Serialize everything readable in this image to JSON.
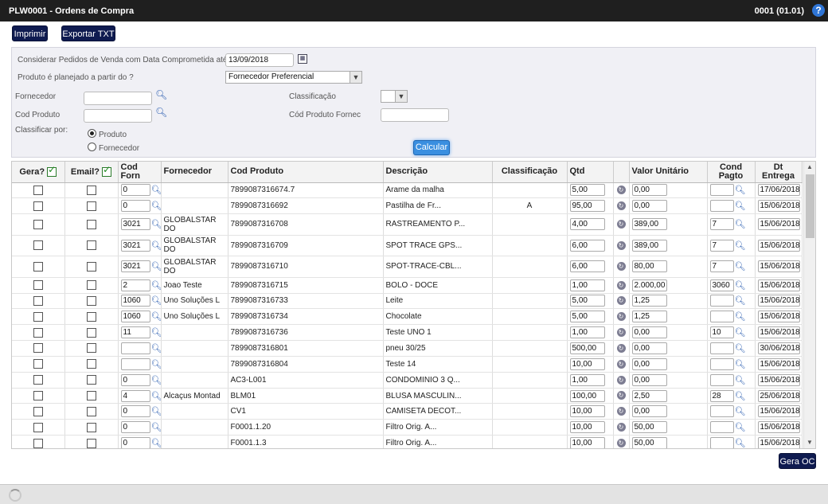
{
  "window": {
    "title": "PLW0001 - Ordens de Compra",
    "code": "0001 (01.01)",
    "help": "?"
  },
  "toolbar": {
    "print_label": "Imprimir",
    "export_label": "Exportar TXT"
  },
  "filters": {
    "data_label": "Considerar Pedidos de Venda com Data Comprometida até",
    "data_value": "13/09/2018",
    "planejado_label": "Produto é planejado a partir do ?",
    "planejado_value": "Fornecedor Preferencial",
    "fornecedor_label": "Fornecedor",
    "fornecedor_value": "",
    "cod_produto_label": "Cod Produto",
    "cod_produto_value": "",
    "classificacao_label": "Classificação",
    "classificacao_value": "",
    "cod_produto_fornec_label": "Cód Produto Fornec",
    "cod_produto_fornec_value": "",
    "classificar_label": "Classificar por:",
    "radio_produto": "Produto",
    "radio_fornecedor": "Fornecedor",
    "radio_selected": "Produto",
    "calcular_label": "Calcular"
  },
  "grid": {
    "headers": {
      "gera": "Gera?",
      "email": "Email?",
      "cod_forn": "Cod Forn",
      "fornecedor": "Fornecedor",
      "cod_produto": "Cod Produto",
      "descricao": "Descrição",
      "classificacao": "Classificação",
      "qtd": "Qtd",
      "valor_unitario": "Valor Unitário",
      "cond_pagto": "Cond Pagto",
      "dt_entrega": "Dt Entrega"
    },
    "header_checks": {
      "gera": true,
      "email": true
    },
    "rows": [
      {
        "cod_forn": "0",
        "fornecedor": "",
        "cod_produto": "7899087316674.7",
        "descricao": "Arame da malha",
        "classificacao": "",
        "qtd": "5,00",
        "valor": "0,00",
        "cond": "",
        "dt": "17/06/2018",
        "tall": false
      },
      {
        "cod_forn": "0",
        "fornecedor": "",
        "cod_produto": "7899087316692",
        "descricao": "Pastilha de Fr...",
        "classificacao": "A",
        "qtd": "95,00",
        "valor": "0,00",
        "cond": "",
        "dt": "15/06/2018",
        "tall": false
      },
      {
        "cod_forn": "3021",
        "fornecedor": "GLOBALSTAR DO",
        "cod_produto": "7899087316708",
        "descricao": "RASTREAMENTO P...",
        "classificacao": "",
        "qtd": "4,00",
        "valor": "389,00",
        "cond": "7",
        "dt": "15/06/2018",
        "tall": true
      },
      {
        "cod_forn": "3021",
        "fornecedor": "GLOBALSTAR DO",
        "cod_produto": "7899087316709",
        "descricao": "SPOT TRACE GPS...",
        "classificacao": "",
        "qtd": "6,00",
        "valor": "389,00",
        "cond": "7",
        "dt": "15/06/2018",
        "tall": true
      },
      {
        "cod_forn": "3021",
        "fornecedor": "GLOBALSTAR DO",
        "cod_produto": "7899087316710",
        "descricao": "SPOT-TRACE-CBL...",
        "classificacao": "",
        "qtd": "6,00",
        "valor": "80,00",
        "cond": "7",
        "dt": "15/06/2018",
        "tall": true
      },
      {
        "cod_forn": "2",
        "fornecedor": "Joao Teste",
        "cod_produto": "7899087316715",
        "descricao": "BOLO - DOCE",
        "classificacao": "",
        "qtd": "1,00",
        "valor": "2.000,00",
        "cond": "3060",
        "dt": "15/06/2018",
        "tall": false
      },
      {
        "cod_forn": "1060",
        "fornecedor": "Uno Soluções L",
        "cod_produto": "7899087316733",
        "descricao": "Leite",
        "classificacao": "",
        "qtd": "5,00",
        "valor": "1,25",
        "cond": "",
        "dt": "15/06/2018",
        "tall": false
      },
      {
        "cod_forn": "1060",
        "fornecedor": "Uno Soluções L",
        "cod_produto": "7899087316734",
        "descricao": "Chocolate",
        "classificacao": "",
        "qtd": "5,00",
        "valor": "1,25",
        "cond": "",
        "dt": "15/06/2018",
        "tall": false
      },
      {
        "cod_forn": "11",
        "fornecedor": "",
        "cod_produto": "7899087316736",
        "descricao": "Teste UNO 1",
        "classificacao": "",
        "qtd": "1,00",
        "valor": "0,00",
        "cond": "10",
        "dt": "15/06/2018",
        "tall": false
      },
      {
        "cod_forn": "",
        "fornecedor": "",
        "cod_produto": "7899087316801",
        "descricao": "pneu 30/25",
        "classificacao": "",
        "qtd": "500,00",
        "valor": "0,00",
        "cond": "",
        "dt": "30/06/2018",
        "tall": false
      },
      {
        "cod_forn": "",
        "fornecedor": "",
        "cod_produto": "7899087316804",
        "descricao": "Teste 14",
        "classificacao": "",
        "qtd": "10,00",
        "valor": "0,00",
        "cond": "",
        "dt": "15/06/2018",
        "tall": false
      },
      {
        "cod_forn": "0",
        "fornecedor": "",
        "cod_produto": "AC3-L001",
        "descricao": "CONDOMINIO 3 Q...",
        "classificacao": "",
        "qtd": "1,00",
        "valor": "0,00",
        "cond": "",
        "dt": "15/06/2018",
        "tall": false
      },
      {
        "cod_forn": "4",
        "fornecedor": "Alcaçus Montad",
        "cod_produto": "BLM01",
        "descricao": "BLUSA MASCULIN...",
        "classificacao": "",
        "qtd": "100,00",
        "valor": "2,50",
        "cond": "28",
        "dt": "25/06/2018",
        "tall": false
      },
      {
        "cod_forn": "0",
        "fornecedor": "",
        "cod_produto": "CV1",
        "descricao": "CAMISETA DECOT...",
        "classificacao": "",
        "qtd": "10,00",
        "valor": "0,00",
        "cond": "",
        "dt": "15/06/2018",
        "tall": false
      },
      {
        "cod_forn": "0",
        "fornecedor": "",
        "cod_produto": "F0001.1.20",
        "descricao": "Filtro Orig. A...",
        "classificacao": "",
        "qtd": "10,00",
        "valor": "50,00",
        "cond": "",
        "dt": "15/06/2018",
        "tall": false
      },
      {
        "cod_forn": "0",
        "fornecedor": "",
        "cod_produto": "F0001.1.3",
        "descricao": "Filtro Orig. A...",
        "classificacao": "",
        "qtd": "10,00",
        "valor": "50,00",
        "cond": "",
        "dt": "15/06/2018",
        "tall": false
      }
    ]
  },
  "footer": {
    "gera_oc_label": "Gera OC"
  }
}
